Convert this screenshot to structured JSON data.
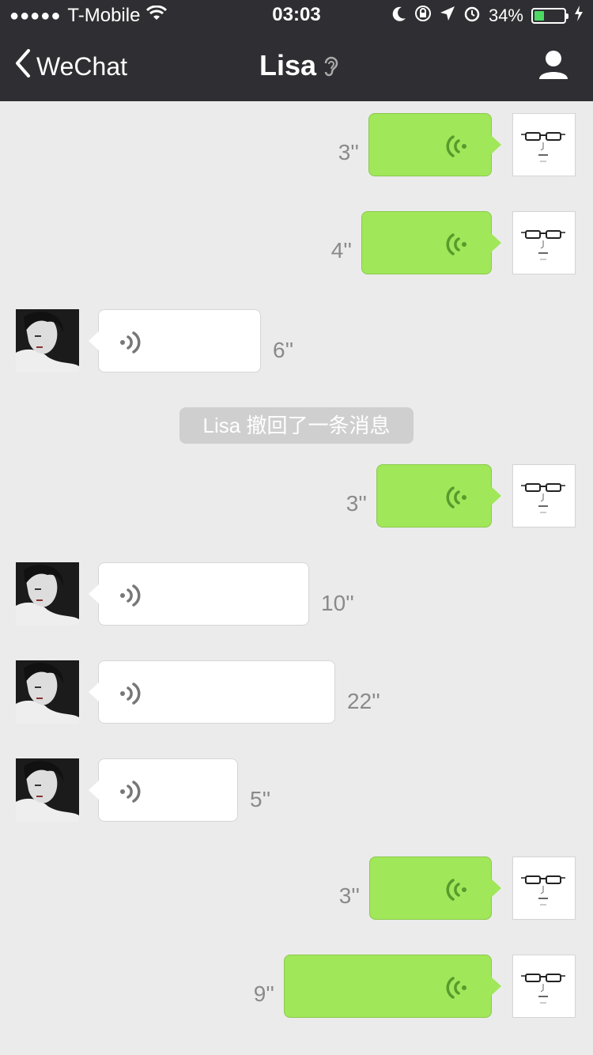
{
  "status_bar": {
    "signal": "●●●●●",
    "carrier": "T-Mobile",
    "time": "03:03",
    "battery_level": "34%",
    "battery_fill_fraction": 0.34
  },
  "nav": {
    "back_label": "WeChat",
    "title": "Lisa"
  },
  "colors": {
    "header_bg": "#2f2f33",
    "chat_bg": "#ebebeb",
    "outgoing_bubble": "#a0e75a",
    "incoming_bubble": "#ffffff",
    "battery": "#4cd964"
  },
  "messages": [
    {
      "direction": "out",
      "duration": "3''"
    },
    {
      "direction": "out",
      "duration": "4''"
    },
    {
      "direction": "in",
      "duration": "6''"
    },
    {
      "system": "Lisa 撤回了一条消息"
    },
    {
      "direction": "out",
      "duration": "3''"
    },
    {
      "direction": "in",
      "duration": "10''"
    },
    {
      "direction": "in",
      "duration": "22''"
    },
    {
      "direction": "in",
      "duration": "5''"
    },
    {
      "direction": "out",
      "duration": "3''"
    },
    {
      "direction": "out",
      "duration": "9''"
    }
  ]
}
